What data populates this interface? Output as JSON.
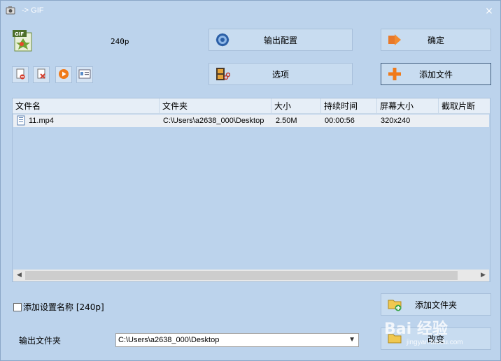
{
  "window": {
    "title": "-> GIF",
    "close_glyph": "×"
  },
  "profile": {
    "label": "240p"
  },
  "buttons": {
    "output_config": "输出配置",
    "ok": "确定",
    "options": "选项",
    "add_file": "添加文件",
    "add_folder": "添加文件夹",
    "change": "改变"
  },
  "toolbar_icons": [
    "remove-file-icon",
    "clear-list-icon",
    "play-icon",
    "info-icon"
  ],
  "list": {
    "columns": [
      "文件名",
      "文件夹",
      "大小",
      "持续时间",
      "屏幕大小",
      "截取片断"
    ],
    "rows": [
      {
        "name": "11.mp4",
        "folder": "C:\\Users\\a2638_000\\Desktop",
        "size": "2.50M",
        "duration": "00:00:56",
        "screen": "320x240",
        "clip": ""
      }
    ]
  },
  "options": {
    "add_setting_name_label": "添加设置名称 [240p]",
    "checked": false
  },
  "output": {
    "label": "输出文件夹",
    "folder_value": "C:\\Users\\a2638_000\\Desktop"
  },
  "watermark": {
    "text": "Bai 经验",
    "sub": "jingyan.baidu.com"
  }
}
